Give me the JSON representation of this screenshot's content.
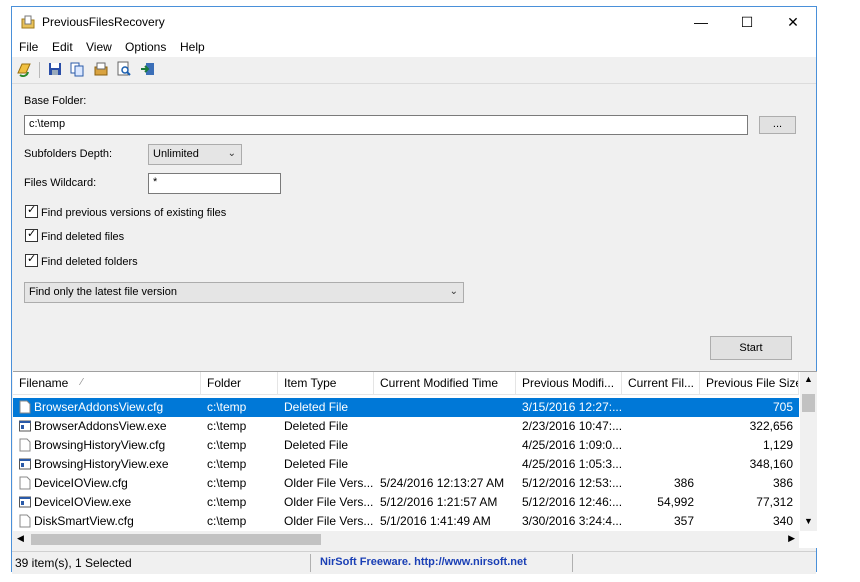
{
  "window": {
    "title": "PreviousFilesRecovery",
    "min": "—",
    "max": "☐",
    "close": "✕"
  },
  "menu": [
    "File",
    "Edit",
    "View",
    "Options",
    "Help"
  ],
  "form": {
    "base_folder_label": "Base Folder:",
    "base_folder_value": "c:\\temp",
    "browse_label": "...",
    "depth_label": "Subfolders Depth:",
    "depth_value": "Unlimited",
    "wildcard_label": "Files Wildcard:",
    "wildcard_value": "*",
    "check1": "Find previous versions of existing files",
    "check2": "Find deleted files",
    "check3": "Find deleted folders",
    "version_mode": "Find only the latest file version",
    "start_label": "Start"
  },
  "table": {
    "columns": [
      "Filename",
      "Folder",
      "Item Type",
      "Current Modified Time",
      "Previous Modifi...",
      "Current Fil...",
      "Previous File Size"
    ],
    "rows": [
      [
        "BrowserAddonsView.cfg",
        "c:\\temp",
        "Deleted File",
        "",
        "3/15/2016 12:27:...",
        "",
        "705"
      ],
      [
        "BrowserAddonsView.exe",
        "c:\\temp",
        "Deleted File",
        "",
        "2/23/2016 10:47:...",
        "",
        "322,656"
      ],
      [
        "BrowsingHistoryView.cfg",
        "c:\\temp",
        "Deleted File",
        "",
        "4/25/2016 1:09:0...",
        "",
        "1,129"
      ],
      [
        "BrowsingHistoryView.exe",
        "c:\\temp",
        "Deleted File",
        "",
        "4/25/2016 1:05:3...",
        "",
        "348,160"
      ],
      [
        "DeviceIOView.cfg",
        "c:\\temp",
        "Older File Vers...",
        "5/24/2016 12:13:27 AM",
        "5/12/2016 12:53:...",
        "386",
        "386"
      ],
      [
        "DeviceIOView.exe",
        "c:\\temp",
        "Older File Vers...",
        "5/12/2016 1:21:57 AM",
        "5/12/2016 12:46:...",
        "54,992",
        "77,312"
      ],
      [
        "DiskSmartView.cfg",
        "c:\\temp",
        "Older File Vers...",
        "5/1/2016 1:41:49 AM",
        "3/30/2016 3:24:4...",
        "357",
        "340"
      ]
    ]
  },
  "status": {
    "count": "39 item(s), 1 Selected",
    "credit": "NirSoft Freeware.  http://www.nirsoft.net"
  },
  "colors": {
    "selection": "#0078d7",
    "link": "#1a3fb5"
  }
}
